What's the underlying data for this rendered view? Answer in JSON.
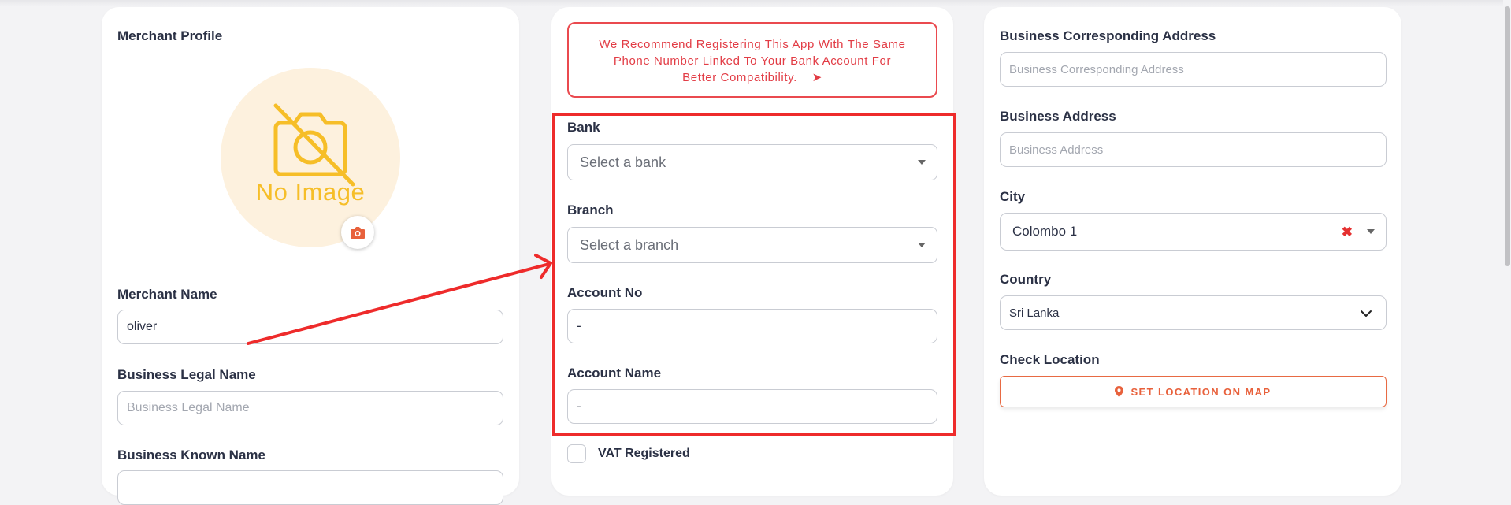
{
  "left_card": {
    "section_title": "Merchant Profile",
    "no_image_text": "No Image",
    "merchant_name_label": "Merchant Name",
    "merchant_name_value": "oliver",
    "business_legal_name_label": "Business Legal Name",
    "business_legal_name_placeholder": "Business Legal Name",
    "business_known_name_label": "Business Known Name"
  },
  "middle_card": {
    "notice_line1": "We Recommend Registering This App With The Same",
    "notice_line2": "Phone Number Linked To Your Bank Account For",
    "notice_line3": "Better Compatibility.",
    "notice_arrow": "➤",
    "bank_label": "Bank",
    "bank_placeholder": "Select a bank",
    "branch_label": "Branch",
    "branch_placeholder": "Select a branch",
    "account_no_label": "Account No",
    "account_no_value": "-",
    "account_name_label": "Account Name",
    "account_name_value": "-",
    "vat_label": "VAT Registered"
  },
  "right_card": {
    "corresponding_address_label": "Business Corresponding Address",
    "corresponding_address_placeholder": "Business Corresponding Address",
    "business_address_label": "Business Address",
    "business_address_placeholder": "Business Address",
    "city_label": "City",
    "city_value": "Colombo 1",
    "country_label": "Country",
    "country_value": "Sri Lanka",
    "check_location_label": "Check Location",
    "set_location_button": "SET LOCATION ON MAP"
  },
  "icons": {
    "no_image": "camera-slash-icon",
    "camera_button": "camera-icon",
    "map_pin": "map-pin-icon",
    "clear": "clear-x-icon",
    "dropdown": "caret-down-icon",
    "chevron": "chevron-down-icon"
  },
  "colors": {
    "accent_orange": "#e8613c",
    "notice_red": "#e23c45",
    "highlight_red": "#ee2b2b",
    "avatar_bg": "#fdf1de",
    "avatar_icon": "#f6be28"
  }
}
